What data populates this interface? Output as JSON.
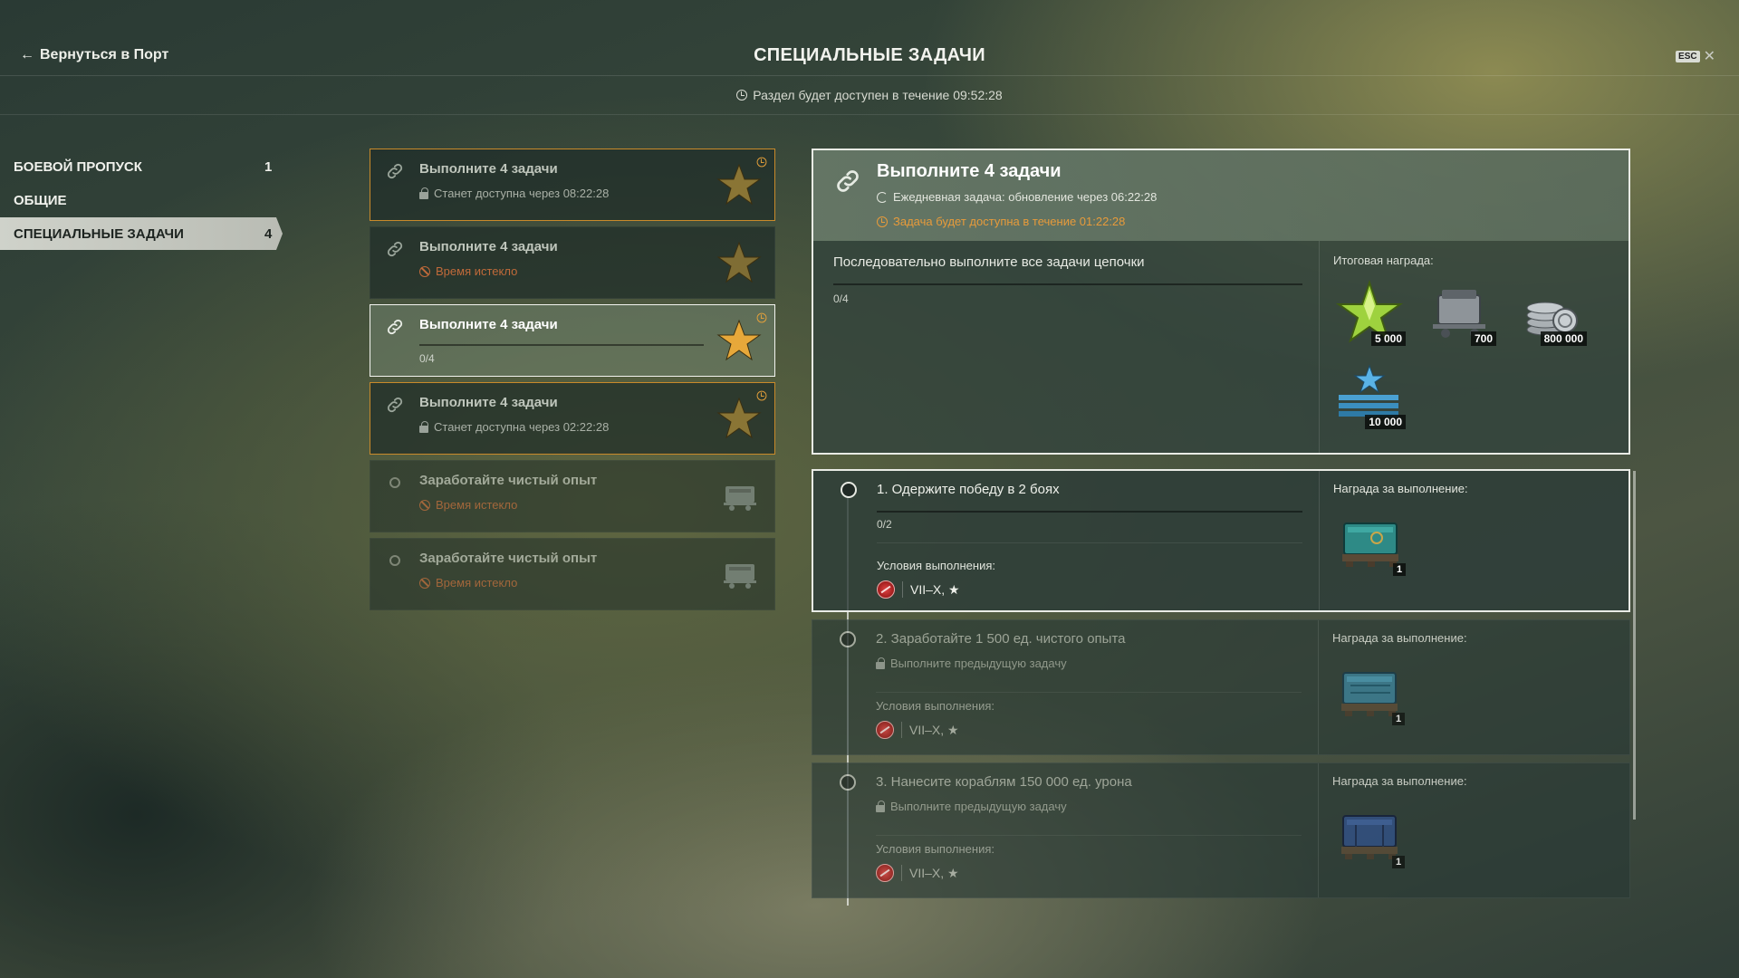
{
  "header": {
    "back_label": "Вернуться в Порт",
    "title": "СПЕЦИАЛЬНЫЕ ЗАДАЧИ",
    "esc_key": "ESC",
    "close_glyph": "✕",
    "availability": "Раздел будет доступен в течение 09:52:28"
  },
  "sidebar": {
    "items": [
      {
        "label": "БОЕВОЙ ПРОПУСК",
        "count": "1"
      },
      {
        "label": "ОБЩИЕ",
        "count": ""
      },
      {
        "label": "СПЕЦИАЛЬНЫЕ ЗАДАЧИ",
        "count": "4"
      }
    ]
  },
  "tasks": [
    {
      "title": "Выполните 4 задачи",
      "subtitle": "Станет доступна через 08:22:28",
      "icon": "link-icon",
      "reward_icon": "star-icon"
    },
    {
      "title": "Выполните 4 задачи",
      "subtitle": "Время истекло",
      "icon": "link-icon",
      "reward_icon": "star-icon"
    },
    {
      "title": "Выполните 4 задачи",
      "progress_text": "0/4",
      "icon": "link-icon",
      "reward_icon": "star-icon"
    },
    {
      "title": "Выполните 4 задачи",
      "subtitle": "Станет доступна через 02:22:28",
      "icon": "link-icon",
      "reward_icon": "star-icon"
    },
    {
      "title": "Заработайте чистый опыт",
      "subtitle": "Время истекло",
      "icon": "circle-icon",
      "reward_icon": "cart-icon"
    },
    {
      "title": "Заработайте чистый опыт",
      "subtitle": "Время истекло",
      "icon": "circle-icon",
      "reward_icon": "cart-icon"
    }
  ],
  "detail": {
    "title": "Выполните 4 задачи",
    "daily": "Ежедневная задача: обновление через 06:22:28",
    "available": "Задача будет доступна в течение 01:22:28",
    "description": "Последовательно выполните все задачи цепочки",
    "progress_text": "0/4",
    "reward_title": "Итоговая награда:",
    "rewards": [
      {
        "icon": "star-reward-icon",
        "amount": "5 000"
      },
      {
        "icon": "cart-reward-icon",
        "amount": "700"
      },
      {
        "icon": "credits-reward-icon",
        "amount": "800 000"
      },
      {
        "icon": "free-xp-reward-icon",
        "amount": "10 000"
      }
    ]
  },
  "steps": [
    {
      "title": "1. Одержите победу в 2 боях",
      "progress_text": "0/2",
      "conditions_label": "Условия выполнения:",
      "conditions": "VII–X, ★",
      "reward_title": "Награда за выполнение:",
      "reward_amount": "1",
      "crate_color": "#2e8a86"
    },
    {
      "title": "2. Заработайте 1 500 ед. чистого опыта",
      "lock_text": "Выполните предыдущую задачу",
      "conditions_label": "Условия выполнения:",
      "conditions": "VII–X, ★",
      "reward_title": "Награда за выполнение:",
      "reward_amount": "1",
      "crate_color": "#3a7e96"
    },
    {
      "title": "3. Нанесите кораблям 150 000 ед. урона",
      "lock_text": "Выполните предыдущую задачу",
      "conditions_label": "Условия выполнения:",
      "conditions": "VII–X, ★",
      "reward_title": "Награда за выполнение:",
      "reward_amount": "1",
      "crate_color": "#2f4f86"
    }
  ],
  "colors": {
    "accent_orange": "#e79b3b",
    "expired_red": "#c06a3a",
    "star_gold": "#d9a93a"
  }
}
